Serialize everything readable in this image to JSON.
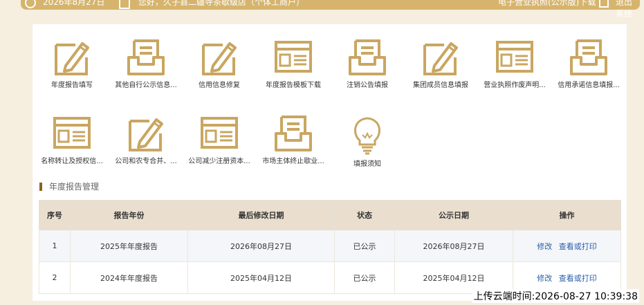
{
  "topbar": {
    "date": "2026年8月27日",
    "welcome": "您好，久子县二疆寺茶歇级店（个体工商户）",
    "download": "电子营业执照(公示版)下载",
    "exit": "退出系统"
  },
  "icons": [
    {
      "label": "年度报告填写",
      "icon": "edit-icon"
    },
    {
      "label": "其他自行公示信息...",
      "icon": "inbox-icon"
    },
    {
      "label": "信用信息修复",
      "icon": "edit-icon"
    },
    {
      "label": "年度报告模板下载",
      "icon": "window-icon"
    },
    {
      "label": "注销公告填报",
      "icon": "inbox-icon"
    },
    {
      "label": "集团成员信息填报",
      "icon": "edit-icon"
    },
    {
      "label": "营业执照作废声明...",
      "icon": "window-icon"
    },
    {
      "label": "信用承诺信息填报...",
      "icon": "inbox-icon"
    },
    {
      "label": "名称转让及授权信...",
      "icon": "window-icon"
    },
    {
      "label": "公司和农专合并、...",
      "icon": "edit-icon"
    },
    {
      "label": "公司减少注册资本...",
      "icon": "window-icon"
    },
    {
      "label": "市场主体终止歇业...",
      "icon": "inbox-icon"
    },
    {
      "label": "填报须知",
      "icon": "lightbulb-icon"
    }
  ],
  "section": {
    "title": "年度报告管理"
  },
  "table": {
    "headers": [
      "序号",
      "报告年份",
      "最后修改日期",
      "状态",
      "公示日期",
      "操作"
    ],
    "rows": [
      {
        "no": "1",
        "year": "2025年年度报告",
        "modified": "2026年08月27日",
        "status": "已公示",
        "published": "2026年08月27日",
        "op1": "修改",
        "op2": "查看或打印"
      },
      {
        "no": "2",
        "year": "2024年年度报告",
        "modified": "2025年04月12日",
        "status": "已公示",
        "published": "2025年04月12日",
        "op1": "修改",
        "op2": "查看或打印"
      }
    ]
  },
  "watermark": "上传云端时间:2026-08-27 10:39:38",
  "colors": {
    "gold": "#c9a661",
    "gold_dark": "#8a6420"
  }
}
